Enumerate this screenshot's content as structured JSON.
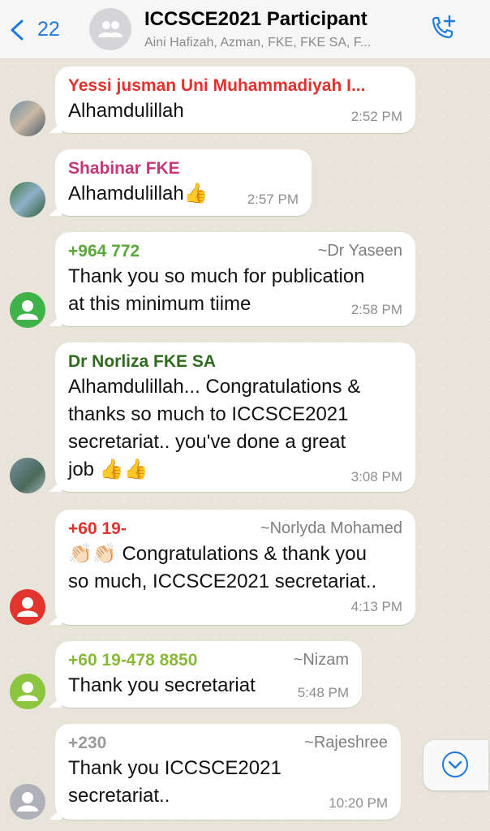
{
  "header": {
    "back_count": "22",
    "title": "ICCSCE2021 Participant",
    "subtitle": "Aini Hafizah, Azman, FKE, FKE SA, F..."
  },
  "messages": [
    {
      "sender": "Yessi jusman Uni Muhammadiyah I...",
      "sender_color": "#e0322e",
      "alias": "",
      "lines": [
        "Alhamdulillah"
      ],
      "time": "2:52 PM"
    },
    {
      "sender": "Shabinar FKE",
      "sender_color": "#c8367a",
      "alias": "",
      "lines": [
        "Alhamdulillah"
      ],
      "emoji_after": "👍",
      "time": "2:57 PM"
    },
    {
      "sender": "+964 772",
      "sender_color": "#5aa83a",
      "alias": "~Dr Yaseen",
      "lines": [
        "Thank you so much for publication",
        "at this minimum tiime"
      ],
      "time": "2:58 PM"
    },
    {
      "sender": "Dr Norliza FKE SA",
      "sender_color": "#2e6b1e",
      "alias": "",
      "lines": [
        "Alhamdulillah... Congratulations &",
        "thanks so much to ICCSCE2021",
        "secretariat.. you've done a great",
        "job"
      ],
      "emoji_after": "👍👍",
      "time": "3:08 PM"
    },
    {
      "sender": "+60 19-",
      "sender_color": "#e0322e",
      "alias": "~Norlyda Mohamed",
      "lines": [
        "Congratulations & thank you",
        "so much, ICCSCE2021 secretariat.."
      ],
      "emoji_before": "👏🏻👏🏻",
      "time": "4:13 PM"
    },
    {
      "sender": "+60 19-478 8850",
      "sender_color": "#8ab83a",
      "alias": "~Nizam",
      "lines": [
        "Thank you secretariat"
      ],
      "time": "5:48 PM"
    },
    {
      "sender": "+230",
      "sender_color": "#9a9a9a",
      "alias": "~Rajeshree",
      "lines": [
        "Thank you ICCSCE2021",
        "secretariat.."
      ],
      "time": "10:20 PM"
    }
  ],
  "colors": {
    "accent": "#1f7ae0",
    "avatar_green": "#3fb24a",
    "avatar_red": "#e0342c",
    "avatar_lime": "#8cc63f",
    "avatar_gray": "#b0b0b8"
  }
}
